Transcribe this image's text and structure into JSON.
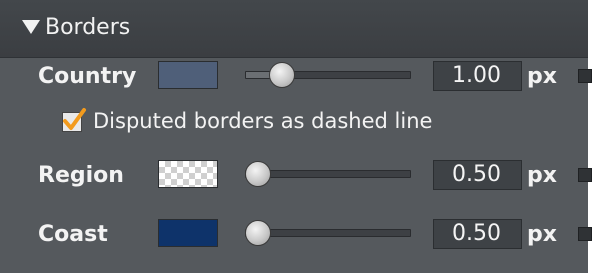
{
  "header": {
    "title": "Borders"
  },
  "rows": [
    {
      "label": "Country",
      "swatch_color": "#4f5f79",
      "slider_fraction": 0.2,
      "value": "1.00",
      "unit": "px"
    },
    {
      "label": "Region",
      "swatch_color": "transparent",
      "slider_fraction": 0.05,
      "value": "0.50",
      "unit": "px"
    },
    {
      "label": "Coast",
      "swatch_color": "#0e336a",
      "slider_fraction": 0.05,
      "value": "0.50",
      "unit": "px"
    }
  ],
  "disputed": {
    "label": "Disputed borders as dashed line",
    "checked": true,
    "check_color": "#f39b1d"
  },
  "icons": {
    "collapse": "triangle-down-icon",
    "check": "checkmark-icon"
  }
}
